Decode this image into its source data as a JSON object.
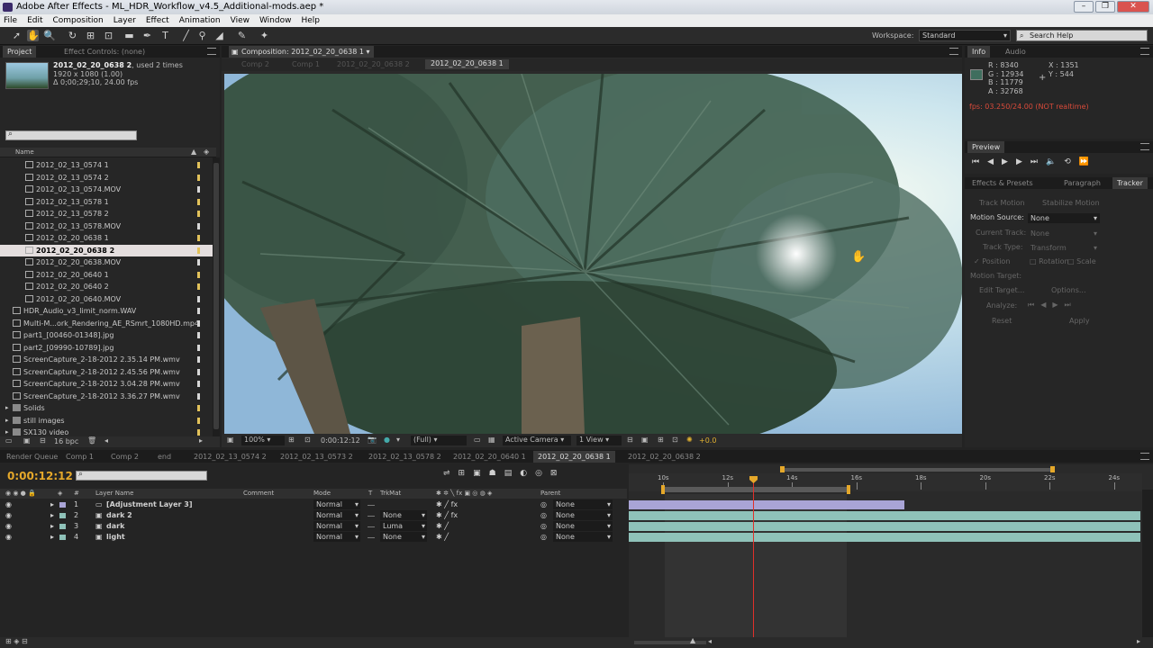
{
  "window": {
    "title": "Adobe After Effects - ML_HDR_Workflow_v4.5_Additional-mods.aep *",
    "buttons": [
      "–",
      "❐",
      "✕"
    ]
  },
  "menu": [
    "File",
    "Edit",
    "Composition",
    "Layer",
    "Effect",
    "Animation",
    "View",
    "Window",
    "Help"
  ],
  "workspace": {
    "label": "Workspace:",
    "value": "Standard",
    "search_placeholder": "Search Help"
  },
  "project": {
    "tab_project": "Project",
    "tab_effect_controls": "Effect Controls: (none)",
    "selected_name": "2012_02_20_0638 2",
    "used": ", used 2 times",
    "dims": "1920 x 1080 (1.00)",
    "duration": "Δ 0;00;29;10, 24.00 fps",
    "column_name": "Name",
    "bpc": "16 bpc",
    "items": [
      {
        "name": "2012_02_13_0574 1",
        "type": "comp",
        "indent": 1,
        "label": "#e2c25a"
      },
      {
        "name": "2012_02_13_0574 2",
        "type": "comp",
        "indent": 1,
        "label": "#e2c25a"
      },
      {
        "name": "2012_02_13_0574.MOV",
        "type": "file",
        "indent": 1,
        "label": "#d7d7d7"
      },
      {
        "name": "2012_02_13_0578 1",
        "type": "comp",
        "indent": 1,
        "label": "#e2c25a"
      },
      {
        "name": "2012_02_13_0578 2",
        "type": "comp",
        "indent": 1,
        "label": "#e2c25a"
      },
      {
        "name": "2012_02_13_0578.MOV",
        "type": "file",
        "indent": 1,
        "label": "#d7d7d7"
      },
      {
        "name": "2012_02_20_0638 1",
        "type": "comp",
        "indent": 1,
        "label": "#e2c25a"
      },
      {
        "name": "2012_02_20_0638 2",
        "type": "comp",
        "indent": 1,
        "label": "#e2c25a",
        "selected": true
      },
      {
        "name": "2012_02_20_0638.MOV",
        "type": "file",
        "indent": 1,
        "label": "#d7d7d7"
      },
      {
        "name": "2012_02_20_0640 1",
        "type": "comp",
        "indent": 1,
        "label": "#e2c25a"
      },
      {
        "name": "2012_02_20_0640 2",
        "type": "comp",
        "indent": 1,
        "label": "#e2c25a"
      },
      {
        "name": "2012_02_20_0640.MOV",
        "type": "file",
        "indent": 1,
        "label": "#d7d7d7"
      },
      {
        "name": "HDR_Audio_v3_limit_norm.WAV",
        "type": "file",
        "indent": 0,
        "label": "#d7d7d7"
      },
      {
        "name": "Multi-M...ork_Rendering_AE_RSmrt_1080HD.mp4",
        "type": "file",
        "indent": 0,
        "label": "#d7d7d7"
      },
      {
        "name": "part1_[00460-01348].jpg",
        "type": "file",
        "indent": 0,
        "label": "#d7d7d7"
      },
      {
        "name": "part2_[09990-10789].jpg",
        "type": "file",
        "indent": 0,
        "label": "#d7d7d7"
      },
      {
        "name": "ScreenCapture_2-18-2012 2.35.14 PM.wmv",
        "type": "file",
        "indent": 0,
        "label": "#d7d7d7"
      },
      {
        "name": "ScreenCapture_2-18-2012 2.45.56 PM.wmv",
        "type": "file",
        "indent": 0,
        "label": "#d7d7d7"
      },
      {
        "name": "ScreenCapture_2-18-2012 3.04.28 PM.wmv",
        "type": "file",
        "indent": 0,
        "label": "#d7d7d7"
      },
      {
        "name": "ScreenCapture_2-18-2012 3.36.27 PM.wmv",
        "type": "file",
        "indent": 0,
        "label": "#d7d7d7"
      },
      {
        "name": "Solids",
        "type": "folder",
        "indent": 0,
        "label": "#e2c25a"
      },
      {
        "name": "still images",
        "type": "folder",
        "indent": 0,
        "label": "#e2c25a"
      },
      {
        "name": "SX130 video",
        "type": "folder",
        "indent": 0,
        "label": "#e2c25a"
      }
    ]
  },
  "composition": {
    "panel_tab": "Composition: 2012_02_20_0638 1",
    "breadcrumbs": [
      "Comp 2",
      "Comp 1",
      "2012_02_20_0638 2",
      "2012_02_20_0638 1"
    ],
    "zoom": "100%",
    "timecode": "0:00:12:12",
    "resolution": "(Full)",
    "camera": "Active Camera",
    "views": "1 View",
    "exposure": "+0.0"
  },
  "info": {
    "tab_info": "Info",
    "tab_audio": "Audio",
    "r": "R : 8340",
    "g": "G : 12934",
    "b": "B : 11779",
    "a": "A : 32768",
    "x": "X : 1351",
    "y": "Y : 544",
    "fps": "fps: 03.250/24.00 (NOT realtime)",
    "swatch": "#3f6e5e"
  },
  "preview": {
    "tab": "Preview"
  },
  "tracker": {
    "tabs": [
      "Effects & Presets",
      "Paragraph",
      "Tracker"
    ],
    "track_motion": "Track Motion",
    "stabilize_motion": "Stabilize Motion",
    "motion_source_label": "Motion Source:",
    "motion_source": "None",
    "current_track_label": "Current Track:",
    "current_track": "None",
    "track_type_label": "Track Type:",
    "track_type": "Transform",
    "position": "Position",
    "rotation": "Rotation",
    "scale": "Scale",
    "motion_target": "Motion Target:",
    "edit_target": "Edit Target...",
    "options": "Options...",
    "analyze": "Analyze:",
    "reset": "Reset",
    "apply": "Apply"
  },
  "timeline": {
    "tabs": [
      "Render Queue",
      "Comp 1",
      "Comp 2",
      "end",
      "2012_02_13_0574 2",
      "2012_02_13_0573 2",
      "2012_02_13_0578 2",
      "2012_02_20_0640 1",
      "2012_02_20_0638 1",
      "2012_02_20_0638 2"
    ],
    "active_tab": 8,
    "timecode": "0:00:12:12",
    "columns": {
      "layer_name": "Layer Name",
      "comment": "Comment",
      "mode": "Mode",
      "t": "T",
      "trkmat": "TrkMat",
      "parent": "Parent"
    },
    "ruler": [
      "10s",
      "12s",
      "14s",
      "16s",
      "18s",
      "20s",
      "22s",
      "24s"
    ],
    "layers": [
      {
        "num": "1",
        "name": "[Adjustment Layer 3]",
        "mode": "Normal",
        "trkmat": "",
        "parent": "None",
        "color": "#a9a4d6"
      },
      {
        "num": "2",
        "name": "dark 2",
        "mode": "Normal",
        "trkmat": "None",
        "parent": "None",
        "color": "#8fc2b9"
      },
      {
        "num": "3",
        "name": "dark",
        "mode": "Normal",
        "trkmat": "Luma",
        "parent": "None",
        "color": "#8fc2b9"
      },
      {
        "num": "4",
        "name": "light",
        "mode": "Normal",
        "trkmat": "None",
        "parent": "None",
        "color": "#8fc2b9"
      }
    ]
  }
}
